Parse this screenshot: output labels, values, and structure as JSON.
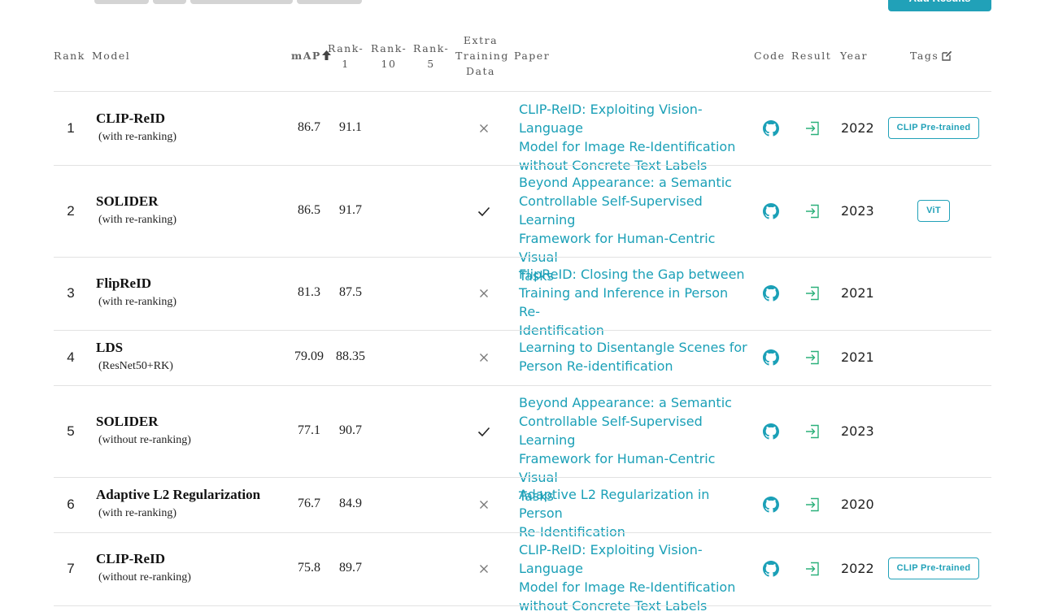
{
  "toolbar": {
    "add_results_label": "Add Results"
  },
  "header": {
    "rank": "Rank",
    "model": "Model",
    "map": "mAP",
    "rank1": [
      "Rank-",
      "1"
    ],
    "rank10": [
      "Rank-",
      "10"
    ],
    "rank5": [
      "Rank-",
      "5"
    ],
    "extra": [
      "Extra",
      "Training",
      "Data"
    ],
    "paper": "Paper",
    "code": "Code",
    "result": "Result",
    "year": "Year",
    "tags": "Tags"
  },
  "colors": {
    "accent": "#21a1b8",
    "link": "#1ba0b7",
    "divider": "#e2e2e2"
  },
  "rows": [
    {
      "rank": "1",
      "model": "CLIP-ReID",
      "variant": "(with re-ranking)",
      "map": "86.7",
      "rank1": "91.1",
      "extra": "cross-icon",
      "paper": [
        "CLIP-ReID: Exploiting Vision-Language",
        "Model for Image Re-Identification",
        "without Concrete Text Labels"
      ],
      "year": "2022",
      "tag": "CLIP Pre-trained"
    },
    {
      "rank": "2",
      "model": "SOLIDER",
      "variant": "(with re-ranking)",
      "map": "86.5",
      "rank1": "91.7",
      "extra": "check-icon",
      "paper": [
        "Beyond Appearance: a Semantic",
        "Controllable Self-Supervised Learning",
        "Framework for Human-Centric Visual",
        "Tasks"
      ],
      "year": "2023",
      "tag": "ViT"
    },
    {
      "rank": "3",
      "model": "FlipReID",
      "variant": "(with re-ranking)",
      "map": "81.3",
      "rank1": "87.5",
      "extra": "cross-icon",
      "paper": [
        "FlipReID: Closing the Gap between",
        "Training and Inference in Person Re-",
        "Identification"
      ],
      "year": "2021",
      "tag": ""
    },
    {
      "rank": "4",
      "model": "LDS",
      "variant": "(ResNet50+RK)",
      "map": "79.09",
      "rank1": "88.35",
      "extra": "cross-icon",
      "paper": [
        "Learning to Disentangle Scenes for",
        "Person Re-identification"
      ],
      "year": "2021",
      "tag": ""
    },
    {
      "rank": "5",
      "model": "SOLIDER",
      "variant": "(without re-ranking)",
      "map": "77.1",
      "rank1": "90.7",
      "extra": "check-icon",
      "paper": [
        "Beyond Appearance: a Semantic",
        "Controllable Self-Supervised Learning",
        "Framework for Human-Centric Visual",
        "Tasks"
      ],
      "year": "2023",
      "tag": ""
    },
    {
      "rank": "6",
      "model": "Adaptive L2 Regularization",
      "variant": "(with re-ranking)",
      "map": "76.7",
      "rank1": "84.9",
      "extra": "cross-icon",
      "paper": [
        "Adaptive L2 Regularization in Person",
        "Re-Identification"
      ],
      "year": "2020",
      "tag": ""
    },
    {
      "rank": "7",
      "model": "CLIP-ReID",
      "variant": "(without re-ranking)",
      "map": "75.8",
      "rank1": "89.7",
      "extra": "cross-icon",
      "paper": [
        "CLIP-ReID: Exploiting Vision-Language",
        "Model for Image Re-Identification",
        "without Concrete Text Labels"
      ],
      "year": "2022",
      "tag": "CLIP Pre-trained"
    }
  ]
}
